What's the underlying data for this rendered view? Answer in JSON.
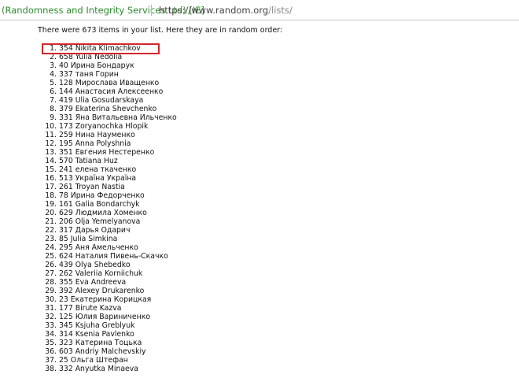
{
  "browser": {
    "site_identity": "(Randomness and Integrity Services Ltd) [IE]",
    "url_host": "https://www.random.org",
    "url_path": "/lists/"
  },
  "intro_text": "There were 673 items in your list. Here they are in random order:",
  "list": [
    {
      "num": "1.",
      "value": "354 Nikita Klimachkov"
    },
    {
      "num": "2.",
      "value": "658 Yulia Nedolia"
    },
    {
      "num": "3.",
      "value": "40 Ирина Бондарук"
    },
    {
      "num": "4.",
      "value": "337 таня Горин"
    },
    {
      "num": "5.",
      "value": "128 Мирослава Иващенко"
    },
    {
      "num": "6.",
      "value": "144 Анастасия Алексеенко"
    },
    {
      "num": "7.",
      "value": "419 Ulia Gosudarskaya"
    },
    {
      "num": "8.",
      "value": "379 Ekaterina Shevchenko"
    },
    {
      "num": "9.",
      "value": "331 Яна Витальевна Ильченко"
    },
    {
      "num": "10.",
      "value": "173 Zoryanochka Hlopik"
    },
    {
      "num": "11.",
      "value": "259 Нина Науменко"
    },
    {
      "num": "12.",
      "value": "195 Anna Polyshnia"
    },
    {
      "num": "13.",
      "value": "351 Евгения Нестеренко"
    },
    {
      "num": "14.",
      "value": "570 Tatiana Huz"
    },
    {
      "num": "15.",
      "value": "241 елена ткаченко"
    },
    {
      "num": "16.",
      "value": "513 Україна Україна"
    },
    {
      "num": "17.",
      "value": "261 Troyan Nastia"
    },
    {
      "num": "18.",
      "value": "78 Ирина Федорченко"
    },
    {
      "num": "19.",
      "value": "161 Galia Bondarchyk"
    },
    {
      "num": "20.",
      "value": "629 Людмила Хоменко"
    },
    {
      "num": "21.",
      "value": "206 Olja Yemelyanova"
    },
    {
      "num": "22.",
      "value": "317 Дарья Одарич"
    },
    {
      "num": "23.",
      "value": "85 Julia Simkina"
    },
    {
      "num": "24.",
      "value": "295 Аня Амельченко"
    },
    {
      "num": "25.",
      "value": "624 Наталия Пивень-Скачко"
    },
    {
      "num": "26.",
      "value": "439 Olya Shebedko"
    },
    {
      "num": "27.",
      "value": "262 Valeriia Korniichuk"
    },
    {
      "num": "28.",
      "value": "355 Eva Andreeva"
    },
    {
      "num": "29.",
      "value": "392 Alexey Drukarenko"
    },
    {
      "num": "30.",
      "value": "23 Екатерина Корицкая"
    },
    {
      "num": "31.",
      "value": "177 Birute Kazva"
    },
    {
      "num": "32.",
      "value": "125 Юлия Вариниченко"
    },
    {
      "num": "33.",
      "value": "345 Ksjuha Greblyuk"
    },
    {
      "num": "34.",
      "value": "314 Ksenia Pavlenko"
    },
    {
      "num": "35.",
      "value": "323 Катерина Тоцька"
    },
    {
      "num": "36.",
      "value": "603 Andriy Malchevskiy"
    },
    {
      "num": "37.",
      "value": "25 Ольга Штефан"
    },
    {
      "num": "38.",
      "value": "332 Anyutka Minaeva"
    }
  ],
  "colors": {
    "site_identity": "#2e8b2e",
    "highlight_border": "#d2262c"
  }
}
